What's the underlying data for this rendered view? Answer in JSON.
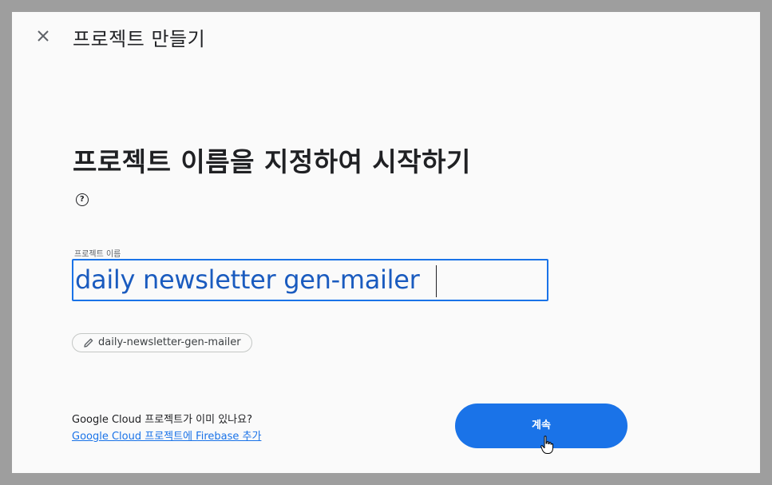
{
  "dialog": {
    "title": "프로젝트 만들기",
    "heading": "프로젝트 이름을 지정하여 시작하기",
    "help_icon": "?",
    "field_label": "프로젝트 이름",
    "project_name_value": "daily newsletter gen-mailer",
    "project_id_chip": "daily-newsletter-gen-mailer",
    "existing_question": "Google Cloud 프로젝트가 이미 있나요?",
    "existing_link": "Google Cloud 프로젝트에 Firebase 추가",
    "continue_label": "계속"
  },
  "icons": {
    "close": "close-icon",
    "help": "help-icon",
    "pencil": "pencil-icon",
    "cursor": "hand-pointer-icon"
  },
  "colors": {
    "accent": "#1a73e8",
    "background": "#fafafa",
    "overlay": "#9e9e9e"
  }
}
